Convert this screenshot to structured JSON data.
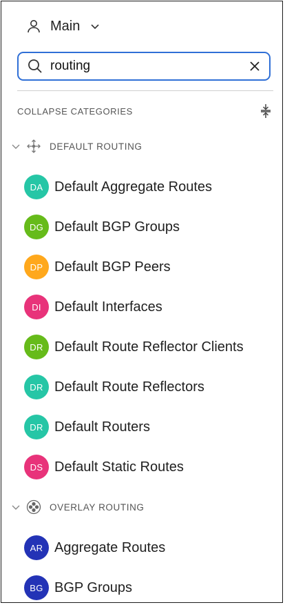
{
  "workspace": {
    "label": "Main"
  },
  "search": {
    "value": "routing"
  },
  "collapse": {
    "label": "COLLAPSE CATEGORIES"
  },
  "categories": [
    {
      "label": "DEFAULT ROUTING",
      "items": [
        {
          "initials": "DA",
          "label": "Default Aggregate Routes",
          "color": "#26c6a6"
        },
        {
          "initials": "DG",
          "label": "Default BGP Groups",
          "color": "#66bb1a"
        },
        {
          "initials": "DP",
          "label": "Default BGP Peers",
          "color": "#ffa81c"
        },
        {
          "initials": "DI",
          "label": "Default Interfaces",
          "color": "#e8337a"
        },
        {
          "initials": "DR",
          "label": "Default Route Reflector Clients",
          "color": "#66bb1a"
        },
        {
          "initials": "DR",
          "label": "Default Route Reflectors",
          "color": "#26c6a6"
        },
        {
          "initials": "DR",
          "label": "Default Routers",
          "color": "#26c6a6"
        },
        {
          "initials": "DS",
          "label": "Default Static Routes",
          "color": "#e8337a"
        }
      ]
    },
    {
      "label": "OVERLAY ROUTING",
      "items": [
        {
          "initials": "AR",
          "label": "Aggregate Routes",
          "color": "#2333b6"
        },
        {
          "initials": "BG",
          "label": "BGP Groups",
          "color": "#2333b6"
        }
      ]
    }
  ]
}
